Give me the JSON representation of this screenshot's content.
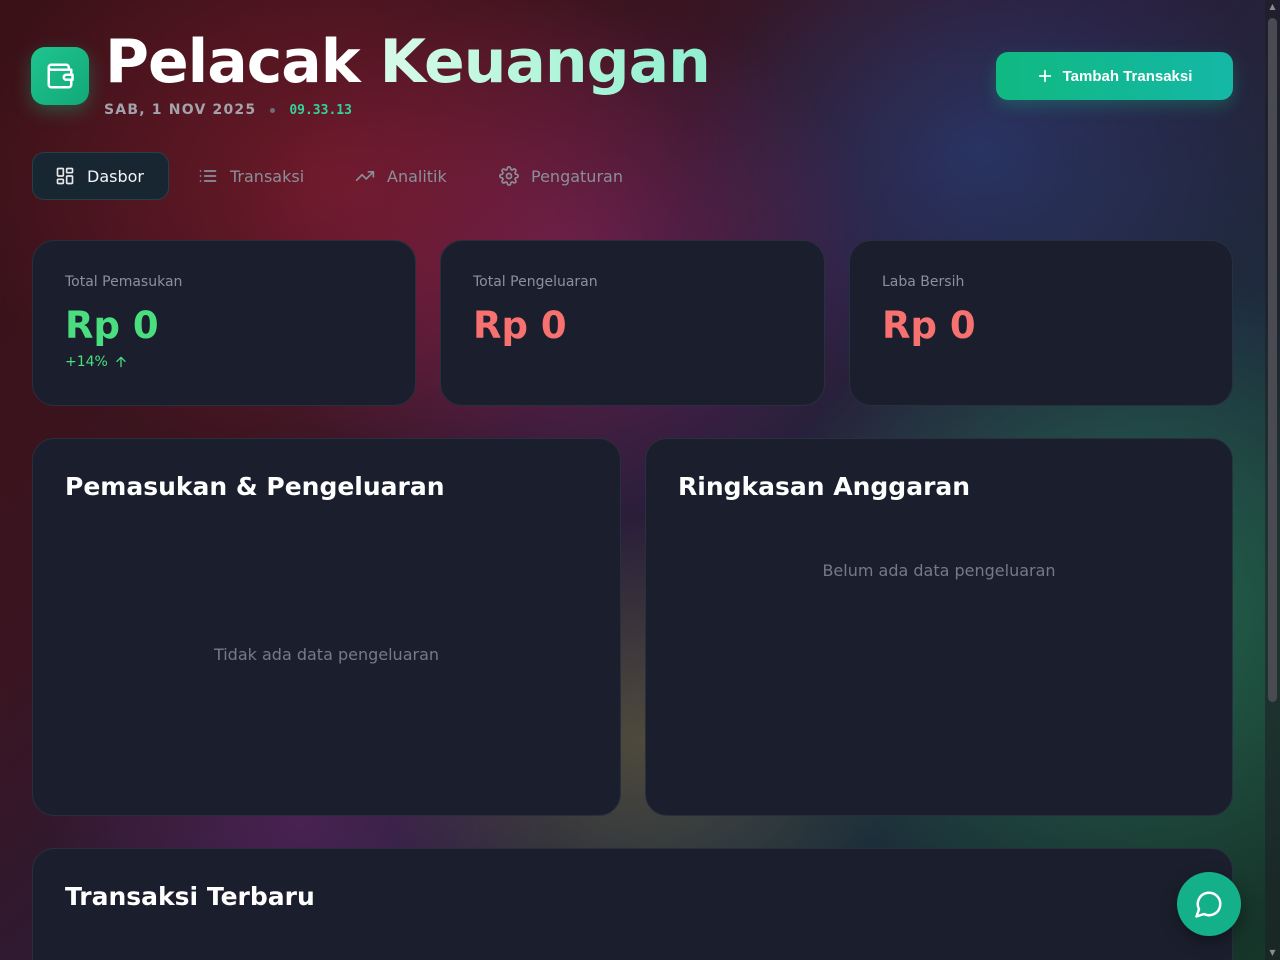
{
  "header": {
    "title_part1": "Pelacak",
    "title_part2": "Keuangan",
    "date": "SAB, 1 NOV 2025",
    "time": "09.33.13",
    "add_button_label": "Tambah Transaksi"
  },
  "tabs": [
    {
      "label": "Dasbor",
      "icon": "dashboard-grid-icon",
      "active": true
    },
    {
      "label": "Transaksi",
      "icon": "list-icon",
      "active": false
    },
    {
      "label": "Analitik",
      "icon": "trending-up-icon",
      "active": false
    },
    {
      "label": "Pengaturan",
      "icon": "gear-icon",
      "active": false
    }
  ],
  "stats": [
    {
      "label": "Total Pemasukan",
      "value": "Rp 0",
      "trend": "+14%"
    },
    {
      "label": "Total Pengeluaran",
      "value": "Rp 0"
    },
    {
      "label": "Laba Bersih",
      "value": "Rp 0"
    }
  ],
  "panels": {
    "income_expense": {
      "title": "Pemasukan & Pengeluaran",
      "empty": "Tidak ada data pengeluaran"
    },
    "budget": {
      "title": "Ringkasan Anggaran",
      "empty": "Belum ada data pengeluaran"
    },
    "recent": {
      "title": "Transaksi Terbaru"
    }
  },
  "colors": {
    "accent": "#10b981",
    "income": "#4ade80",
    "expense": "#f87171",
    "card_bg": "#1b1f2d"
  }
}
